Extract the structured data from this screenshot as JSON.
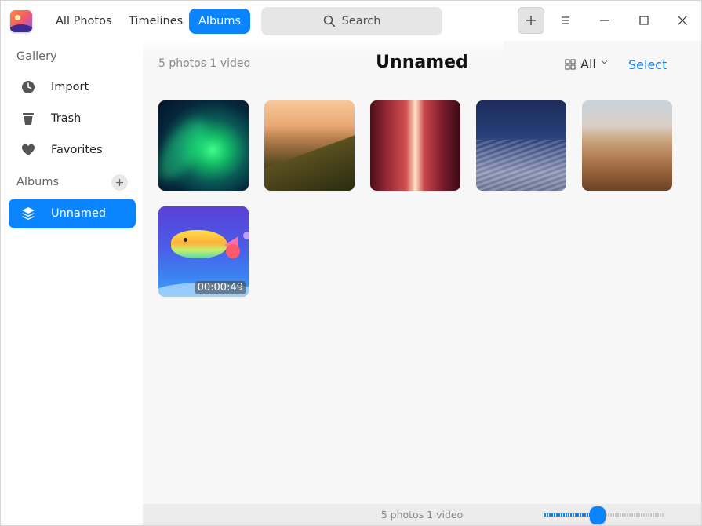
{
  "titlebar": {
    "tabs": [
      {
        "label": "All Photos",
        "active": false
      },
      {
        "label": "Timelines",
        "active": false
      },
      {
        "label": "Albums",
        "active": true
      }
    ],
    "search_label": "Search",
    "icons": {
      "logo": "app-logo-icon",
      "add": "plus-icon",
      "menu": "menu-icon",
      "minimize": "minimize-icon",
      "maximize": "maximize-icon",
      "close": "close-icon"
    }
  },
  "sidebar": {
    "gallery_heading": "Gallery",
    "gallery_items": [
      {
        "label": "Import",
        "icon": "clock-icon"
      },
      {
        "label": "Trash",
        "icon": "trash-icon"
      },
      {
        "label": "Favorites",
        "icon": "heart-icon"
      }
    ],
    "albums_heading": "Albums",
    "albums": [
      {
        "label": "Unnamed",
        "icon": "layers-icon",
        "active": true
      }
    ]
  },
  "main": {
    "count_text": "5 photos 1 video",
    "title": "Unnamed",
    "filter_label": "All",
    "select_label": "Select",
    "thumbnails": [
      {
        "kind": "photo",
        "subject": "aurora"
      },
      {
        "kind": "photo",
        "subject": "mountain sunset"
      },
      {
        "kind": "photo",
        "subject": "red canyon"
      },
      {
        "kind": "photo",
        "subject": "night desert dunes"
      },
      {
        "kind": "photo",
        "subject": "desert dunes"
      },
      {
        "kind": "video",
        "subject": "whale illustration",
        "duration": "00:00:49"
      }
    ]
  },
  "statusbar": {
    "count_text": "5 photos 1 video",
    "zoom_level": 0.45
  },
  "colors": {
    "accent": "#0a84ff"
  }
}
